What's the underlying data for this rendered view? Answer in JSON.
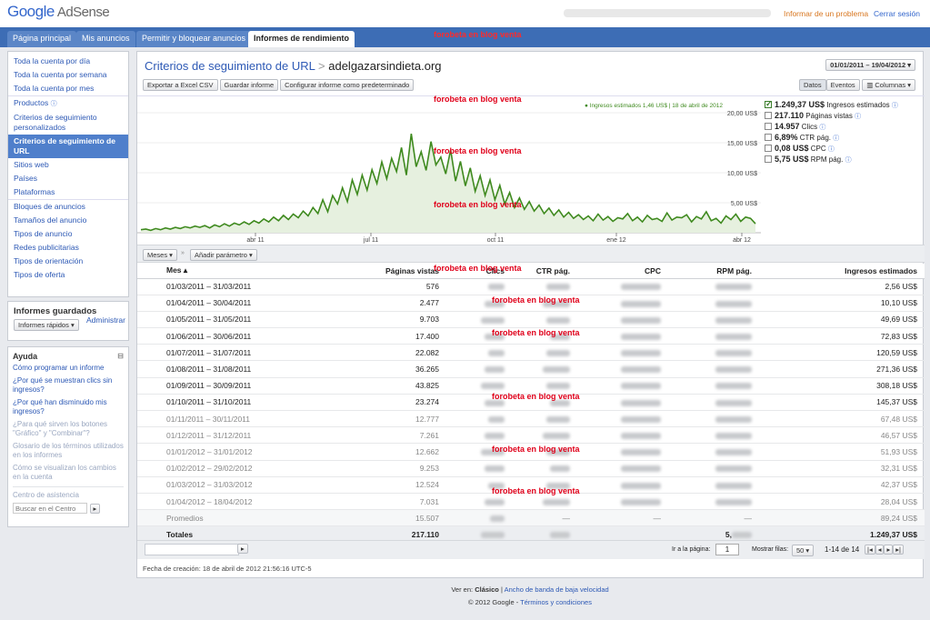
{
  "header": {
    "logo_google": "Google",
    "logo_product": "AdSense",
    "report_problem": "Informar de un problema",
    "sign_out": "Cerrar sesión"
  },
  "nav": {
    "tabs": [
      "Página principal",
      "Mis anuncios",
      "Permitir y bloquear anuncios",
      "Informes de rendimiento"
    ],
    "active": "Informes de rendimiento"
  },
  "watermark": "forobeta en blog venta",
  "sidebar": {
    "items": [
      "Toda la cuenta por día",
      "Toda la cuenta por semana",
      "Toda la cuenta por mes",
      "Productos",
      "Criterios de seguimiento personalizados",
      "Criterios de seguimiento de URL",
      "Sitios web",
      "Países",
      "Plataformas",
      "Bloques de anuncios",
      "Tamaños del anuncio",
      "Tipos de anuncio",
      "Redes publicitarias",
      "Tipos de orientación",
      "Tipos de oferta"
    ],
    "selected": "Criterios de seguimiento de URL"
  },
  "saved_reports": {
    "title": "Informes guardados",
    "quick_button": "Informes rápidos ▾",
    "manage": "Administrar"
  },
  "help": {
    "title": "Ayuda",
    "links": [
      "Cómo programar un informe",
      "¿Por qué se muestran clics sin ingresos?",
      "¿Por qué han disminuido mis ingresos?",
      "¿Para qué sirven los botones \"Gráfico\" y \"Combinar\"?",
      "Glosario de los términos utilizados en los informes",
      "Cómo se visualizan los cambios en la cuenta"
    ],
    "center": "Centro de asistencia",
    "search_placeholder": "Buscar en el Centro"
  },
  "report": {
    "title": "Criterios de seguimiento de URL",
    "separator": ">",
    "site": "adelgazarsindieta.org",
    "date_range": "01/01/2011 – 19/04/2012 ▾",
    "toolbar": [
      "Exportar a Excel CSV",
      "Guardar informe",
      "Configurar informe como predeterminado"
    ],
    "view_buttons": [
      "Datos",
      "Eventos",
      "Columnas ▾"
    ],
    "filter_buttons": [
      "Meses ▾",
      "Añadir parámetro ▾"
    ],
    "creation": "Fecha de creación: 18 de abril de 2012 21:56:16 UTC-5"
  },
  "chart_data": {
    "type": "line",
    "series_name": "Ingresos estimados",
    "tooltip": "● Ingresos estimados 1,46 US$ | 18 de abril de 2012",
    "y_ticks": [
      "5,00 US$",
      "10,00 US$",
      "15,00 US$",
      "20,00 US$"
    ],
    "x_ticks": [
      "abr 11",
      "jul 11",
      "oct 11",
      "ene 12",
      "abr 12"
    ],
    "ylim": [
      0,
      20
    ],
    "y": [
      0.5,
      0.6,
      0.4,
      0.7,
      0.5,
      0.8,
      0.6,
      0.9,
      0.7,
      1.0,
      0.8,
      1.1,
      0.9,
      1.2,
      0.8,
      1.3,
      1.0,
      1.5,
      1.1,
      1.6,
      1.3,
      1.8,
      1.4,
      2.0,
      1.6,
      2.3,
      1.8,
      2.6,
      2.0,
      2.9,
      2.2,
      3.1,
      2.5,
      3.6,
      2.8,
      4.2,
      3.2,
      5.5,
      3.5,
      6.2,
      4.8,
      7.5,
      5.2,
      8.8,
      6.4,
      9.6,
      7.1,
      10.5,
      8.2,
      11.8,
      9.0,
      12.4,
      10.2,
      14.2,
      9.6,
      16.5,
      11.0,
      13.5,
      10.4,
      15.2,
      11.3,
      12.6,
      9.8,
      13.8,
      8.6,
      11.9,
      7.8,
      10.8,
      6.9,
      9.5,
      6.2,
      8.8,
      5.5,
      7.9,
      4.8,
      6.7,
      4.2,
      5.8,
      3.9,
      5.2,
      3.6,
      4.6,
      3.2,
      4.1,
      2.9,
      3.8,
      2.6,
      3.4,
      2.4,
      3.0,
      2.2,
      2.8,
      2.0,
      3.1,
      2.1,
      2.7,
      1.9,
      2.5,
      2.3,
      3.2,
      2.0,
      2.6,
      1.8,
      2.9,
      2.2,
      2.4,
      1.9,
      3.3,
      2.1,
      2.6,
      2.5,
      3.0,
      1.8,
      2.7,
      2.3,
      3.5,
      2.0,
      2.4,
      1.6,
      2.8,
      2.2,
      3.1,
      1.9,
      2.6,
      2.4,
      1.5
    ]
  },
  "metrics": [
    {
      "value": "1.249,37 US$",
      "label": "Ingresos estimados",
      "checked": true
    },
    {
      "value": "217.110",
      "label": "Páginas vistas",
      "checked": false
    },
    {
      "value": "14.957",
      "label": "Clics",
      "checked": false
    },
    {
      "value": "6,89%",
      "label": "CTR pág.",
      "checked": false
    },
    {
      "value": "0,08 US$",
      "label": "CPC",
      "checked": false
    },
    {
      "value": "5,75 US$",
      "label": "RPM pág.",
      "checked": false
    }
  ],
  "table": {
    "columns": [
      "Mes ▴",
      "Páginas vistas",
      "Clics",
      "CTR pág.",
      "CPC",
      "RPM pág.",
      "Ingresos estimados"
    ],
    "rows": [
      {
        "mes": "01/03/2011 – 31/03/2011",
        "pv": "576",
        "ing": "2,56 US$"
      },
      {
        "mes": "01/04/2011 – 30/04/2011",
        "pv": "2.477",
        "ing": "10,10 US$"
      },
      {
        "mes": "01/05/2011 – 31/05/2011",
        "pv": "9.703",
        "ing": "49,69 US$"
      },
      {
        "mes": "01/06/2011 – 30/06/2011",
        "pv": "17.400",
        "ing": "72,83 US$"
      },
      {
        "mes": "01/07/2011 – 31/07/2011",
        "pv": "22.082",
        "ing": "120,59 US$"
      },
      {
        "mes": "01/08/2011 – 31/08/2011",
        "pv": "36.265",
        "ing": "271,36 US$"
      },
      {
        "mes": "01/09/2011 – 30/09/2011",
        "pv": "43.825",
        "ing": "308,18 US$"
      },
      {
        "mes": "01/10/2011 – 31/10/2011",
        "pv": "23.274",
        "ing": "145,37 US$"
      },
      {
        "mes": "01/11/2011 – 30/11/2011",
        "pv": "12.777",
        "ing": "67,48 US$"
      },
      {
        "mes": "01/12/2011 – 31/12/2011",
        "pv": "7.261",
        "ing": "46,57 US$"
      },
      {
        "mes": "01/01/2012 – 31/01/2012",
        "pv": "12.662",
        "ing": "51,93 US$"
      },
      {
        "mes": "01/02/2012 – 29/02/2012",
        "pv": "9.253",
        "ing": "32,31 US$"
      },
      {
        "mes": "01/03/2012 – 31/03/2012",
        "pv": "12.524",
        "ing": "42,37 US$"
      },
      {
        "mes": "01/04/2012 – 18/04/2012",
        "pv": "7.031",
        "ing": "28,04 US$"
      }
    ],
    "avg": {
      "label": "Promedios",
      "pv": "15.507",
      "dash": "—",
      "ing": "89,24 US$"
    },
    "total": {
      "label": "Totales",
      "pv": "217.110",
      "rpm_prefix": "5,",
      "ing": "1.249,37 US$"
    }
  },
  "pager": {
    "goto_label": "Ir a la página:",
    "page": "1",
    "show_rows": "Mostrar filas:",
    "rows_select": "50 ▾",
    "range": "1-14 de 14"
  },
  "footer": {
    "view_in": "Ver en:",
    "classic": "Clásico",
    "sep": "|",
    "lowband": "Ancho de banda de baja velocidad",
    "copyright": "© 2012 Google -",
    "terms": "Términos y condiciones"
  }
}
